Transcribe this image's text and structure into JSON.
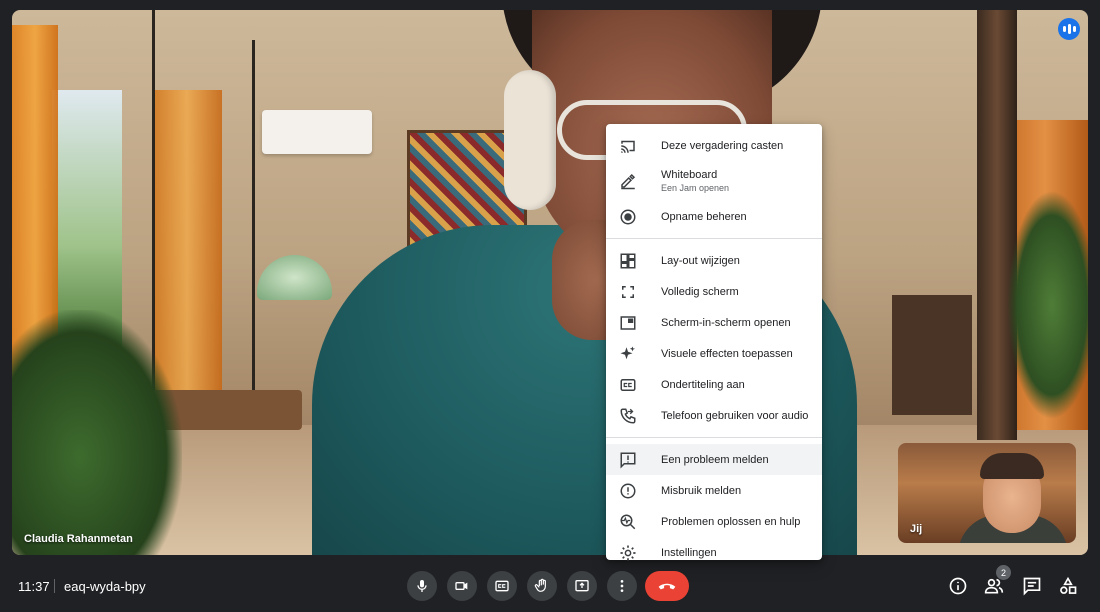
{
  "meeting": {
    "time": "11:37",
    "code": "eaq-wyda-bpy",
    "participant_count": "2"
  },
  "main_participant": {
    "name": "Claudia Rahanmetan"
  },
  "self_view": {
    "label": "Jij"
  },
  "menu": {
    "items": [
      {
        "label": "Deze vergadering casten",
        "icon": "cast-icon"
      },
      {
        "label": "Whiteboard",
        "sublabel": "Een Jam openen",
        "icon": "pen-icon"
      },
      {
        "label": "Opname beheren",
        "icon": "record-icon"
      },
      {
        "label": "Lay-out wijzigen",
        "icon": "layout-icon"
      },
      {
        "label": "Volledig scherm",
        "icon": "fullscreen-icon"
      },
      {
        "label": "Scherm-in-scherm openen",
        "icon": "picture-in-picture-icon"
      },
      {
        "label": "Visuele effecten toepassen",
        "icon": "sparkle-icon"
      },
      {
        "label": "Ondertiteling aan",
        "icon": "captions-icon"
      },
      {
        "label": "Telefoon gebruiken voor audio",
        "icon": "phone-forward-icon"
      },
      {
        "label": "Een probleem melden",
        "icon": "feedback-icon"
      },
      {
        "label": "Misbruik melden",
        "icon": "report-icon"
      },
      {
        "label": "Problemen oplossen en hulp",
        "icon": "troubleshoot-icon"
      },
      {
        "label": "Instellingen",
        "icon": "settings-icon"
      }
    ]
  },
  "colors": {
    "end_call": "#ea4335",
    "control_bg": "#3c4043",
    "bar_bg": "#202124",
    "speaking": "#1a73e8"
  }
}
